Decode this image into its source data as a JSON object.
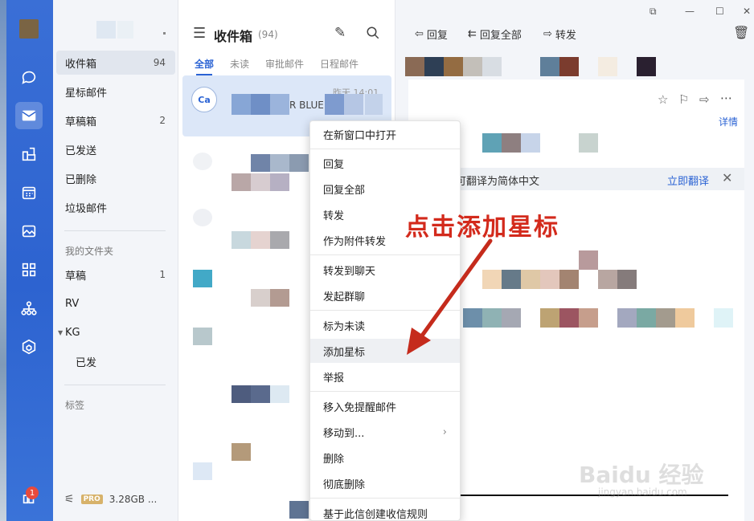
{
  "rail": {
    "items": [
      {
        "icon": "chat-icon"
      },
      {
        "icon": "mail-icon",
        "active": true
      },
      {
        "icon": "share-icon"
      },
      {
        "icon": "calendar-icon"
      },
      {
        "icon": "photo-icon"
      },
      {
        "icon": "apps-icon"
      },
      {
        "icon": "org-icon"
      },
      {
        "icon": "cube-icon"
      }
    ],
    "bottom_badge": "1"
  },
  "folders": {
    "items": [
      {
        "label": "收件箱",
        "count": "94"
      },
      {
        "label": "星标邮件",
        "count": ""
      },
      {
        "label": "草稿箱",
        "count": "2"
      },
      {
        "label": "已发送",
        "count": ""
      },
      {
        "label": "已删除",
        "count": ""
      },
      {
        "label": "垃圾邮件",
        "count": ""
      }
    ],
    "my_folders_header": "我的文件夹",
    "my_folders": [
      {
        "label": "草稿",
        "count": "1"
      },
      {
        "label": "RV",
        "count": ""
      },
      {
        "label": "KG",
        "count": ""
      },
      {
        "label": "已发",
        "count": ""
      }
    ],
    "tags_header": "标签",
    "storage_badge": "PRO",
    "storage": "3.28GB ..."
  },
  "list": {
    "title": "收件箱",
    "count": "(94)",
    "tabs": [
      "全部",
      "未读",
      "审批邮件",
      "日程邮件"
    ],
    "selected_message": {
      "avatar": "Ca",
      "time": "昨天 14:01",
      "snippet": "R BLUE UP"
    }
  },
  "reader": {
    "toolbar": {
      "reply": "回复",
      "reply_all": "回复全部",
      "forward": "转发"
    },
    "detail_link": "详情",
    "translate_text": "件可翻译为简体中文",
    "translate_link": "立即翻译"
  },
  "context_menu": {
    "items": [
      "在新窗口中打开",
      "回复",
      "回复全部",
      "转发",
      "作为附件转发",
      "转发到聊天",
      "发起群聊",
      "标为未读",
      "添加星标",
      "举报",
      "移入免提醒邮件",
      "移动到...",
      "删除",
      "彻底删除",
      "基于此信创建收信规则"
    ]
  },
  "annotation": {
    "text": "点击添加星标"
  },
  "watermark": {
    "main": "Baidu 经验",
    "sub": "jingyan.baidu.com"
  }
}
